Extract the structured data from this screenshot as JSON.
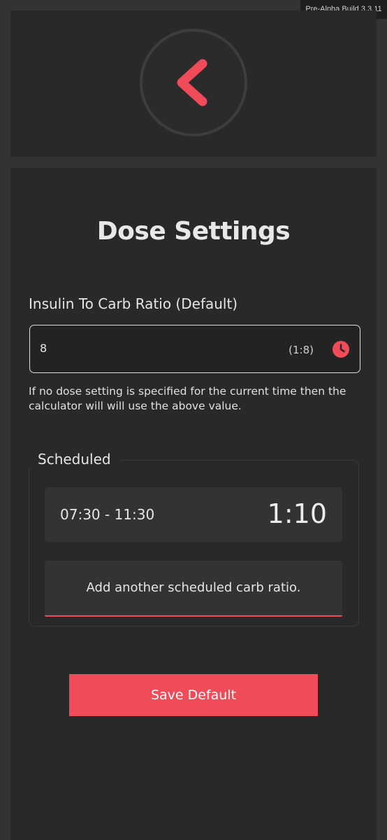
{
  "build": {
    "label": "Pre-Alpha Build 3.3.11"
  },
  "header": {
    "back_icon": "chevron-left-icon"
  },
  "page": {
    "title": "Dose Settings"
  },
  "default_ratio": {
    "label": "Insulin To Carb Ratio (Default)",
    "value": "8",
    "display": "(1:8)",
    "icon": "clock-icon",
    "help_text": "If no dose setting is specified for the current time then the calculator will will use the above value."
  },
  "scheduled": {
    "legend": "Scheduled",
    "items": [
      {
        "time_range": "07:30 - 11:30",
        "ratio": "1:10"
      }
    ],
    "add_label": "Add another scheduled carb ratio."
  },
  "actions": {
    "save_label": "Save Default"
  },
  "colors": {
    "accent": "#ef4b59",
    "panel": "#292929",
    "background": "#333333"
  }
}
